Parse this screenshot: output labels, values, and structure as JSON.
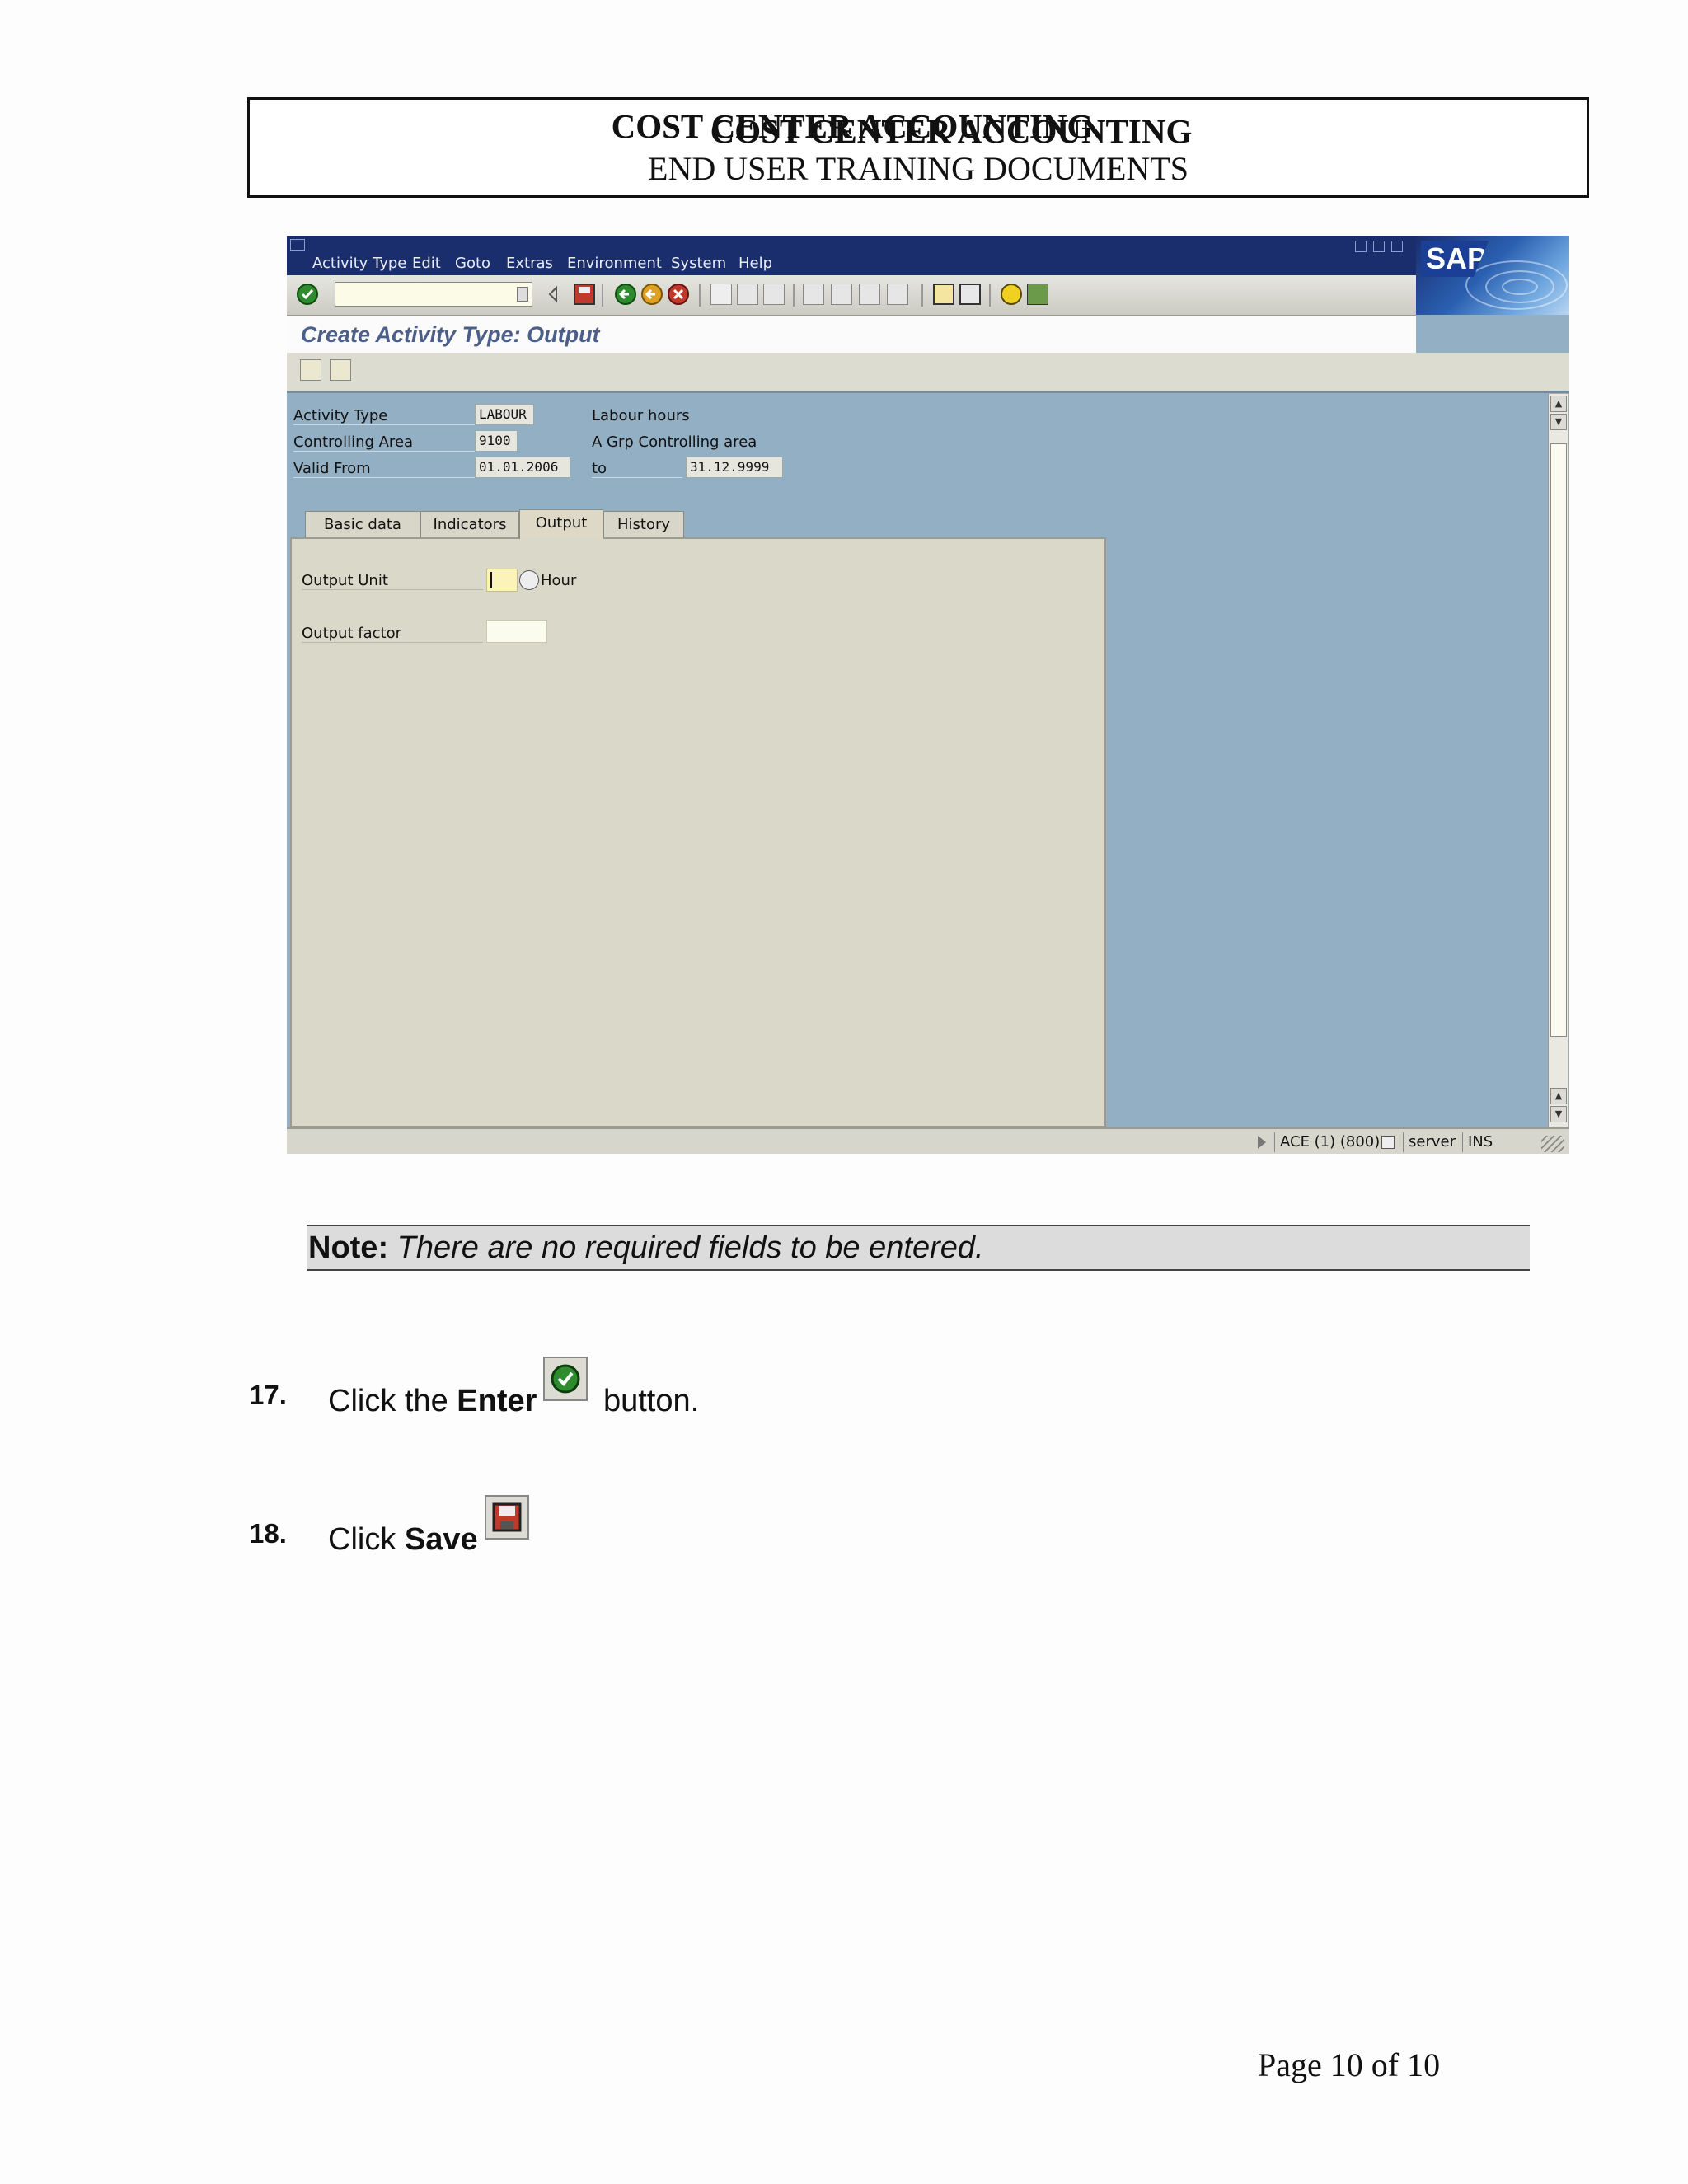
{
  "header": {
    "title": "COST CENTER ACCOUNTING",
    "subtitle": "END USER TRAINING DOCUMENTS"
  },
  "sap": {
    "menu": [
      "Activity Type",
      "Edit",
      "Goto",
      "Extras",
      "Environment",
      "System",
      "Help"
    ],
    "logo": "SAP",
    "screen_title": "Create Activity Type: Output",
    "fields": {
      "activity_type_label": "Activity Type",
      "activity_type_value": "LABOUR",
      "activity_type_desc": "Labour hours",
      "controlling_area_label": "Controlling Area",
      "controlling_area_value": "9100",
      "controlling_area_desc": "A Grp Controlling area",
      "valid_from_label": "Valid From",
      "valid_from_value": "01.01.2006",
      "to_label": "to",
      "valid_to_value": "31.12.9999"
    },
    "tabs": [
      "Basic data",
      "Indicators",
      "Output",
      "History"
    ],
    "active_tab": "Output",
    "output": {
      "output_unit_label": "Output Unit",
      "output_unit_value": "",
      "output_unit_text": "Hour",
      "output_factor_label": "Output factor",
      "output_factor_value": ""
    },
    "status": {
      "system": "ACE (1) (800)",
      "server": "server",
      "mode": "INS"
    },
    "colors": {
      "menubar": "#1a2e6e",
      "background": "#93afc4",
      "panel": "#dad9c9"
    }
  },
  "note": {
    "label": "Note:",
    "text": "There are no required fields to be entered."
  },
  "steps": [
    {
      "number": "17.",
      "prefix": "Click the ",
      "bold": "Enter",
      "suffix": " button.",
      "icon": "enter-checkmark-icon"
    },
    {
      "number": "18.",
      "prefix": "Click ",
      "bold": "Save",
      "suffix": "",
      "icon": "save-floppy-icon"
    }
  ],
  "footer": {
    "page": "Page 10 of 10"
  }
}
